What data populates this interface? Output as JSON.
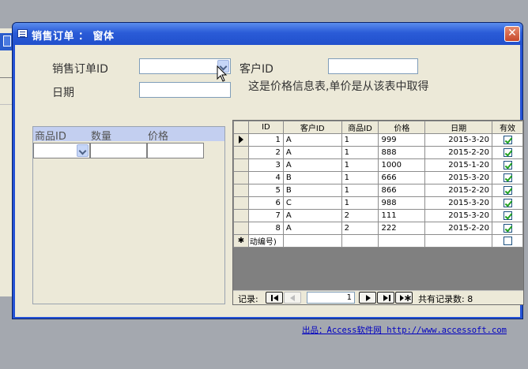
{
  "window": {
    "title": "销售订单 ： 窗体",
    "close_label": "✕"
  },
  "form": {
    "order_id_label": "销售订单ID",
    "order_id_value": "",
    "customer_id_label": "客户ID",
    "customer_id_value": "",
    "date_label": "日期",
    "date_value": "",
    "price_info_note": "这是价格信息表,单价是从该表中取得"
  },
  "detail_subform": {
    "headers": [
      "商品ID",
      "数量",
      "价格"
    ]
  },
  "price_table": {
    "columns": [
      "ID",
      "客户ID",
      "商品ID",
      "价格",
      "日期",
      "有效"
    ],
    "rows": [
      {
        "id": "1",
        "customer": "A",
        "product": "1",
        "price": "999",
        "date": "2015-3-20",
        "valid": true
      },
      {
        "id": "2",
        "customer": "A",
        "product": "1",
        "price": "888",
        "date": "2015-2-20",
        "valid": true
      },
      {
        "id": "3",
        "customer": "A",
        "product": "1",
        "price": "1000",
        "date": "2015-1-20",
        "valid": true
      },
      {
        "id": "4",
        "customer": "B",
        "product": "1",
        "price": "666",
        "date": "2015-3-20",
        "valid": true
      },
      {
        "id": "5",
        "customer": "B",
        "product": "1",
        "price": "866",
        "date": "2015-2-20",
        "valid": true
      },
      {
        "id": "6",
        "customer": "C",
        "product": "1",
        "price": "988",
        "date": "2015-3-20",
        "valid": true
      },
      {
        "id": "7",
        "customer": "A",
        "product": "2",
        "price": "111",
        "date": "2015-3-20",
        "valid": true
      },
      {
        "id": "8",
        "customer": "A",
        "product": "2",
        "price": "222",
        "date": "2015-2-20",
        "valid": true
      }
    ],
    "new_row_marker": "✱",
    "new_row_id": "动编号)",
    "new_row_valid": false
  },
  "navigation": {
    "record_label": "记录:",
    "current_record": "1",
    "total_label": "共有记录数: 8"
  },
  "footer": {
    "credit": "出品：Access软件网 http://www.accessoft.com"
  }
}
